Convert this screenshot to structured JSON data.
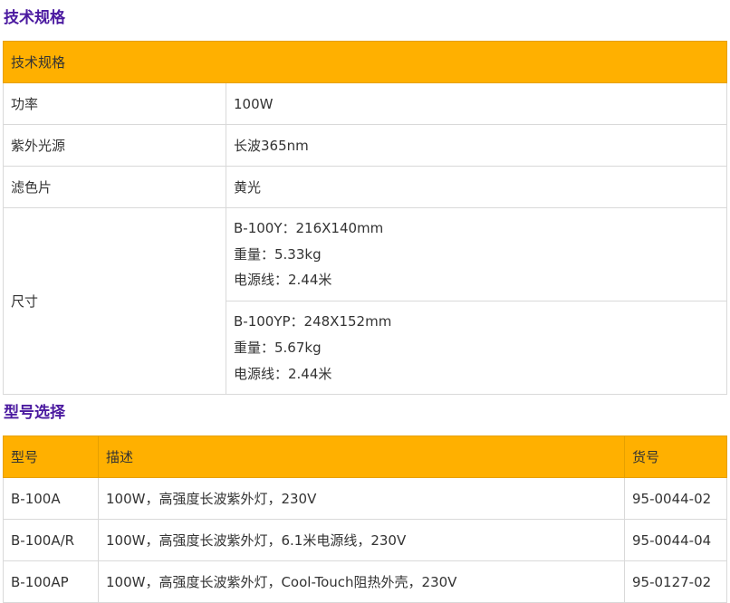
{
  "spec": {
    "section_title": "技术规格",
    "table_header": "技术规格",
    "rows": [
      {
        "label": "功率",
        "value": "100W"
      },
      {
        "label": "紫外光源",
        "value": "长波365nm"
      },
      {
        "label": "滤色片",
        "value": "黄光"
      }
    ],
    "size": {
      "label": "尺寸",
      "variants": [
        {
          "model": "B-100Y：216X140mm",
          "weight": "重量：5.33kg",
          "cord": "电源线：2.44米"
        },
        {
          "model": "B-100YP：248X152mm",
          "weight": "重量：5.67kg",
          "cord": "电源线：2.44米"
        }
      ]
    }
  },
  "models": {
    "section_title": "型号选择",
    "headers": [
      "型号",
      "描述",
      "货号"
    ],
    "rows": [
      {
        "model": "B-100A",
        "desc": "100W，高强度长波紫外灯，230V",
        "sku": "95-0044-02"
      },
      {
        "model": "B-100A/R",
        "desc": "100W，高强度长波紫外灯，6.1米电源线，230V",
        "sku": "95-0044-04"
      },
      {
        "model": "B-100AP",
        "desc": "100W，高强度长波紫外灯，Cool-Touch阻热外壳，230V",
        "sku": "95-0127-02"
      }
    ]
  },
  "colors": {
    "header_bg": "#ffb000",
    "title": "#4b1aa0",
    "border": "#d9d9d9"
  }
}
